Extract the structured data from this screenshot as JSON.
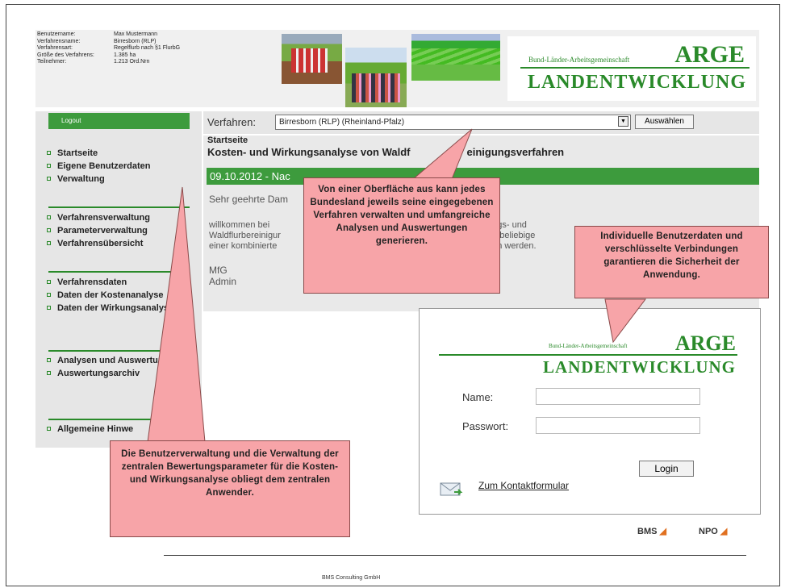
{
  "user_info": [
    {
      "k": "Benutzername:",
      "v": "Max Mustermann"
    },
    {
      "k": "Verfahrensname:",
      "v": "Birresborn (RLP)"
    },
    {
      "k": "Verfahrensart:",
      "v": "Regelflurb nach §1 FlurbG"
    },
    {
      "k": "Größe des Verfahrens:",
      "v": "1.385 ha"
    },
    {
      "k": "Teilnehmer:",
      "v": "1.213 Ord.Nrn"
    }
  ],
  "logo": {
    "small": "Bund-Länder-Arbeitsgemeinschaft",
    "big": "ARGE",
    "land": "LANDENTWICKLUNG"
  },
  "sidebar": {
    "logout": "Logout",
    "groups": [
      [
        "Startseite",
        "Eigene Benutzerdaten",
        "Verwaltung"
      ],
      [
        "Verfahrensverwaltung",
        "Parameterverwaltung",
        "Verfahrensübersicht"
      ],
      [
        "Verfahrensdaten",
        "Daten der Kostenanalyse",
        "Daten der Wirkungsanalyse"
      ],
      [
        "Analysen und Auswertungen",
        "Auswertungsarchiv"
      ],
      [
        "Allgemeine Hinwe"
      ]
    ]
  },
  "topbar": {
    "label": "Verfahren:",
    "selected": "Birresborn (RLP) (Rheinland-Pfalz)",
    "button": "Auswählen"
  },
  "main": {
    "heading1": "Startseite",
    "heading2": "Kosten- und Wirkungsanalyse von Waldf",
    "heading2_tail": "einigungsverfahren",
    "news_date": "09.10.2012 - Nac",
    "greeting": "Sehr geehrte Dam",
    "body_lines": [
      [
        "willkommen    bei",
        "ungs-    und"
      ],
      [
        "Waldflurbereinigur",
        "en beliebige"
      ],
      [
        "einer kombinierte",
        "gen werden."
      ]
    ],
    "sign1": "MfG",
    "sign2": "Admin"
  },
  "login": {
    "name_label": "Name:",
    "password_label": "Passwort:",
    "button": "Login",
    "contact": "Zum Kontaktformular"
  },
  "partners": [
    "BMS",
    "NPO"
  ],
  "footer": "BMS Consulting GmbH",
  "callouts": {
    "center": "Von einer Oberfläche aus kann jedes Bundesland jeweils seine eingegebenen Verfahren verwalten und umfangreiche Analysen und Auswertungen generieren.",
    "right": "Individuelle Benutzerdaten und verschlüsselte Verbindungen garantieren die Sicherheit der Anwendung.",
    "bottom": "Die Benutzerverwaltung und die Verwaltung der zentralen Bewertungsparameter für die Kosten- und Wirkungsanalyse obliegt dem zentralen Anwender."
  },
  "colors": {
    "green": "#3d9b3d",
    "callout": "#f7a4a8"
  }
}
